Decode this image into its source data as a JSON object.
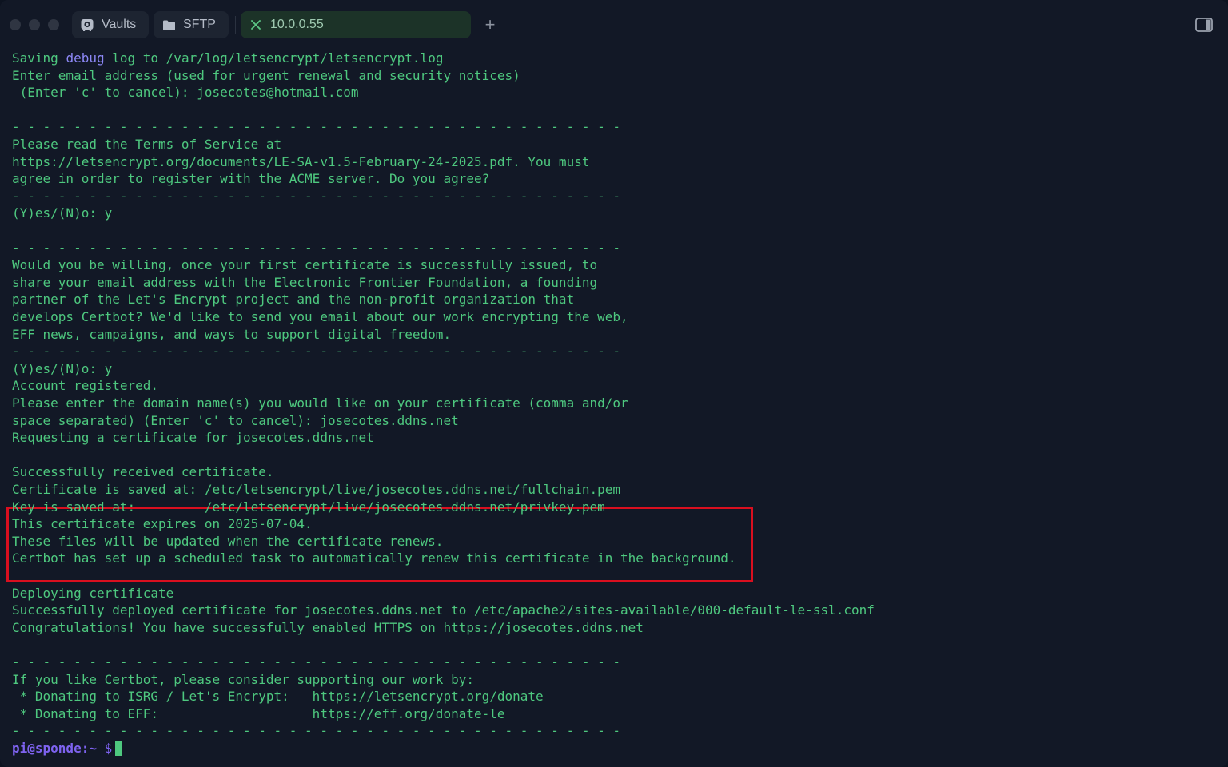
{
  "tabs": [
    {
      "label": "Vaults",
      "icon": "vault-icon"
    },
    {
      "label": "SFTP",
      "icon": "folder-icon"
    },
    {
      "label": "10.0.0.55",
      "icon": "close-icon",
      "active": true
    }
  ],
  "new_tab_symbol": "+",
  "colors": {
    "terminal_text": "#4ec87f",
    "keyword": "#8c87f5",
    "prompt": "#7e63f0",
    "highlight": "#d90f1f",
    "background": "#121826"
  },
  "terminal": {
    "lines": [
      {
        "pre": "Saving ",
        "kw": "debug",
        "post": " log to /var/log/letsencrypt/letsencrypt.log"
      },
      {
        "pre": "Enter email address (used for urgent renewal and security notices)"
      },
      {
        "pre": " (Enter 'c' to cancel): josecotes@hotmail.com"
      },
      {
        "pre": ""
      },
      {
        "pre": "- - - - - - - - - - - - - - - - - - - - - - - - - - - - - - - - - - - - - - - -"
      },
      {
        "pre": "Please read the Terms of Service at"
      },
      {
        "pre": "https://letsencrypt.org/documents/LE-SA-v1.5-February-24-2025.pdf. You must"
      },
      {
        "pre": "agree in order to register with the ACME server. Do you agree?"
      },
      {
        "pre": "- - - - - - - - - - - - - - - - - - - - - - - - - - - - - - - - - - - - - - - -"
      },
      {
        "pre": "(Y)es/(N)o: y"
      },
      {
        "pre": ""
      },
      {
        "pre": "- - - - - - - - - - - - - - - - - - - - - - - - - - - - - - - - - - - - - - - -"
      },
      {
        "pre": "Would you be willing, once your first certificate is successfully issued, to"
      },
      {
        "pre": "share your email address with the Electronic Frontier Foundation, a founding"
      },
      {
        "pre": "partner of the Let's Encrypt project and the non-profit organization that"
      },
      {
        "pre": "develops Certbot? We'd like to send you email about our work encrypting the web,"
      },
      {
        "pre": "EFF news, campaigns, and ways to support digital freedom."
      },
      {
        "pre": "- - - - - - - - - - - - - - - - - - - - - - - - - - - - - - - - - - - - - - - -"
      },
      {
        "pre": "(Y)es/(N)o: y"
      },
      {
        "pre": "Account registered."
      },
      {
        "pre": "Please enter the domain name(s) you would like on your certificate (comma and/or"
      },
      {
        "pre": "space separated) (Enter 'c' to cancel): josecotes.ddns.net"
      },
      {
        "pre": "Requesting a certificate for josecotes.ddns.net"
      },
      {
        "pre": ""
      },
      {
        "pre": "Successfully received certificate."
      },
      {
        "pre": "Certificate is saved at: /etc/letsencrypt/live/josecotes.ddns.net/fullchain.pem"
      },
      {
        "pre": "Key is saved at:         /etc/letsencrypt/live/josecotes.ddns.net/privkey.pem"
      },
      {
        "pre": "This certificate expires on 2025-07-04."
      },
      {
        "pre": "These files will be updated when the certificate renews."
      },
      {
        "pre": "Certbot has set up a scheduled task to automatically renew this certificate in the background."
      },
      {
        "pre": ""
      },
      {
        "pre": "Deploying certificate"
      },
      {
        "pre": "Successfully deployed certificate for josecotes.ddns.net to /etc/apache2/sites-available/000-default-le-ssl.conf"
      },
      {
        "pre": "Congratulations! You have successfully enabled HTTPS on https://josecotes.ddns.net"
      },
      {
        "pre": ""
      },
      {
        "pre": "- - - - - - - - - - - - - - - - - - - - - - - - - - - - - - - - - - - - - - - -"
      },
      {
        "pre": "If you like Certbot, please consider supporting our work by:"
      },
      {
        "pre": " * Donating to ISRG / Let's Encrypt:   https://letsencrypt.org/donate"
      },
      {
        "pre": " * Donating to EFF:                    https://eff.org/donate-le"
      },
      {
        "pre": "- - - - - - - - - - - - - - - - - - - - - - - - - - - - - - - - - - - - - - - -"
      }
    ],
    "prompt": {
      "user_host": "pi@sponde:~",
      "symbol": "$"
    }
  }
}
